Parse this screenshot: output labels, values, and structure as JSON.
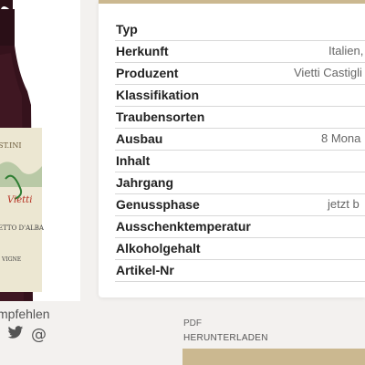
{
  "product": {
    "image": "wine-bottle",
    "label_text": [
      "Vietti",
      "ETTO D'ALBA",
      "VIGNE"
    ]
  },
  "share": {
    "label": "mpfehlen",
    "icons": [
      "twitter-icon",
      "at-icon"
    ]
  },
  "details": {
    "rows": [
      {
        "label": "Typ",
        "value": ""
      },
      {
        "label": "Herkunft",
        "value": "Italien,"
      },
      {
        "label": "Produzent",
        "value": "Vietti Castigli"
      },
      {
        "label": "Klassifikation",
        "value": ""
      },
      {
        "label": "Traubensorten",
        "value": ""
      },
      {
        "label": "Ausbau",
        "value": "8 Mona"
      },
      {
        "label": "Inhalt",
        "value": ""
      },
      {
        "label": "Jahrgang",
        "value": ""
      },
      {
        "label": "Genussphase",
        "value": "jetzt b"
      },
      {
        "label": "Ausschenktemperatur",
        "value": ""
      },
      {
        "label": "Alkoholgehalt",
        "value": ""
      },
      {
        "label": "Artikel-Nr",
        "value": ""
      }
    ]
  },
  "pdf": {
    "label": "PDF",
    "download": "HERUNTERLADEN"
  },
  "colors": {
    "accent": "#cbb890",
    "background": "#f3f1ef"
  }
}
